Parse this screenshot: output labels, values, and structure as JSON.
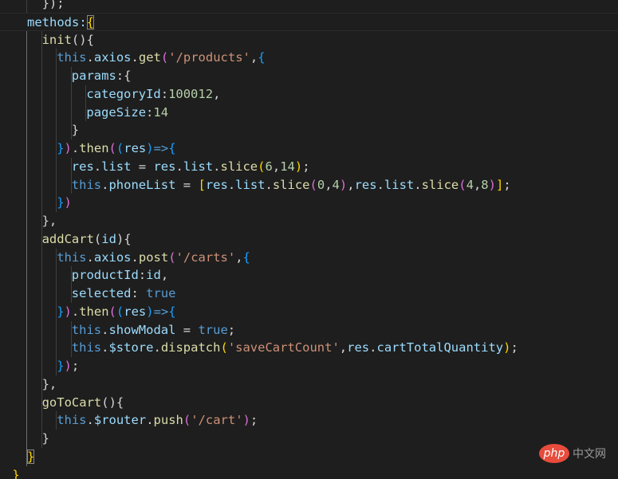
{
  "editor": {
    "lines": [
      {
        "indent": 2,
        "guides": [
          1
        ],
        "tokens": [
          {
            "t": "});",
            "c": "txt"
          }
        ]
      },
      {
        "indent": 1,
        "current": true,
        "guides": [],
        "tokens": [
          {
            "t": "methods:",
            "c": "prop"
          },
          {
            "t": "{",
            "c": "b1 bm"
          }
        ]
      },
      {
        "indent": 2,
        "guides": [
          1,
          2
        ],
        "tokens": [
          {
            "t": "init",
            "c": "fn"
          },
          {
            "t": "(){",
            "c": "txt"
          }
        ]
      },
      {
        "indent": 3,
        "guides": [
          1,
          2,
          3
        ],
        "tokens": [
          {
            "t": "this",
            "c": "kw"
          },
          {
            "t": ".",
            "c": "txt"
          },
          {
            "t": "axios",
            "c": "prop"
          },
          {
            "t": ".",
            "c": "txt"
          },
          {
            "t": "get",
            "c": "fn"
          },
          {
            "t": "(",
            "c": "b2"
          },
          {
            "t": "'/products'",
            "c": "str"
          },
          {
            "t": ",",
            "c": "txt"
          },
          {
            "t": "{",
            "c": "b3"
          }
        ]
      },
      {
        "indent": 4,
        "guides": [
          1,
          2,
          3,
          4
        ],
        "tokens": [
          {
            "t": "params",
            "c": "prop"
          },
          {
            "t": ":{",
            "c": "txt"
          }
        ]
      },
      {
        "indent": 5,
        "guides": [
          1,
          2,
          3,
          4,
          5
        ],
        "tokens": [
          {
            "t": "categoryId",
            "c": "prop"
          },
          {
            "t": ":",
            "c": "txt"
          },
          {
            "t": "100012",
            "c": "num"
          },
          {
            "t": ",",
            "c": "txt"
          }
        ]
      },
      {
        "indent": 5,
        "guides": [
          1,
          2,
          3,
          4,
          5
        ],
        "tokens": [
          {
            "t": "pageSize",
            "c": "prop"
          },
          {
            "t": ":",
            "c": "txt"
          },
          {
            "t": "14",
            "c": "num"
          }
        ]
      },
      {
        "indent": 4,
        "guides": [
          1,
          2,
          3,
          4
        ],
        "tokens": [
          {
            "t": "}",
            "c": "txt"
          }
        ]
      },
      {
        "indent": 3,
        "guides": [
          1,
          2,
          3
        ],
        "tokens": [
          {
            "t": "}",
            "c": "b3"
          },
          {
            "t": ")",
            "c": "b2"
          },
          {
            "t": ".",
            "c": "txt"
          },
          {
            "t": "then",
            "c": "fn"
          },
          {
            "t": "(",
            "c": "b2"
          },
          {
            "t": "(",
            "c": "b3"
          },
          {
            "t": "res",
            "c": "prop"
          },
          {
            "t": ")",
            "c": "b3"
          },
          {
            "t": "=>",
            "c": "kw"
          },
          {
            "t": "{",
            "c": "b3"
          }
        ]
      },
      {
        "indent": 4,
        "guides": [
          1,
          2,
          3,
          4
        ],
        "tokens": [
          {
            "t": "res",
            "c": "prop"
          },
          {
            "t": ".",
            "c": "txt"
          },
          {
            "t": "list",
            "c": "prop"
          },
          {
            "t": " = ",
            "c": "txt"
          },
          {
            "t": "res",
            "c": "prop"
          },
          {
            "t": ".",
            "c": "txt"
          },
          {
            "t": "list",
            "c": "prop"
          },
          {
            "t": ".",
            "c": "txt"
          },
          {
            "t": "slice",
            "c": "fn"
          },
          {
            "t": "(",
            "c": "b1"
          },
          {
            "t": "6",
            "c": "num"
          },
          {
            "t": ",",
            "c": "txt"
          },
          {
            "t": "14",
            "c": "num"
          },
          {
            "t": ")",
            "c": "b1"
          },
          {
            "t": ";",
            "c": "txt"
          }
        ]
      },
      {
        "indent": 4,
        "guides": [
          1,
          2,
          3,
          4
        ],
        "tokens": [
          {
            "t": "this",
            "c": "kw"
          },
          {
            "t": ".",
            "c": "txt"
          },
          {
            "t": "phoneList",
            "c": "prop"
          },
          {
            "t": " = ",
            "c": "txt"
          },
          {
            "t": "[",
            "c": "b1"
          },
          {
            "t": "res",
            "c": "prop"
          },
          {
            "t": ".",
            "c": "txt"
          },
          {
            "t": "list",
            "c": "prop"
          },
          {
            "t": ".",
            "c": "txt"
          },
          {
            "t": "slice",
            "c": "fn"
          },
          {
            "t": "(",
            "c": "b2"
          },
          {
            "t": "0",
            "c": "num"
          },
          {
            "t": ",",
            "c": "txt"
          },
          {
            "t": "4",
            "c": "num"
          },
          {
            "t": ")",
            "c": "b2"
          },
          {
            "t": ",",
            "c": "txt"
          },
          {
            "t": "res",
            "c": "prop"
          },
          {
            "t": ".",
            "c": "txt"
          },
          {
            "t": "list",
            "c": "prop"
          },
          {
            "t": ".",
            "c": "txt"
          },
          {
            "t": "slice",
            "c": "fn"
          },
          {
            "t": "(",
            "c": "b2"
          },
          {
            "t": "4",
            "c": "num"
          },
          {
            "t": ",",
            "c": "txt"
          },
          {
            "t": "8",
            "c": "num"
          },
          {
            "t": ")",
            "c": "b2"
          },
          {
            "t": "]",
            "c": "b1"
          },
          {
            "t": ";",
            "c": "txt"
          }
        ]
      },
      {
        "indent": 3,
        "guides": [
          1,
          2,
          3
        ],
        "tokens": [
          {
            "t": "}",
            "c": "b3"
          },
          {
            "t": ")",
            "c": "b2"
          }
        ]
      },
      {
        "indent": 2,
        "guides": [
          1,
          2
        ],
        "tokens": [
          {
            "t": "},",
            "c": "txt"
          }
        ]
      },
      {
        "indent": 2,
        "guides": [
          1,
          2
        ],
        "tokens": [
          {
            "t": "addCart",
            "c": "fn"
          },
          {
            "t": "(",
            "c": "txt"
          },
          {
            "t": "id",
            "c": "prop"
          },
          {
            "t": "){",
            "c": "txt"
          }
        ]
      },
      {
        "indent": 3,
        "guides": [
          1,
          2,
          3
        ],
        "tokens": [
          {
            "t": "this",
            "c": "kw"
          },
          {
            "t": ".",
            "c": "txt"
          },
          {
            "t": "axios",
            "c": "prop"
          },
          {
            "t": ".",
            "c": "txt"
          },
          {
            "t": "post",
            "c": "fn"
          },
          {
            "t": "(",
            "c": "b2"
          },
          {
            "t": "'/carts'",
            "c": "str"
          },
          {
            "t": ",",
            "c": "txt"
          },
          {
            "t": "{",
            "c": "b3"
          }
        ]
      },
      {
        "indent": 4,
        "guides": [
          1,
          2,
          3,
          4
        ],
        "tokens": [
          {
            "t": "productId",
            "c": "prop"
          },
          {
            "t": ":",
            "c": "txt"
          },
          {
            "t": "id",
            "c": "prop"
          },
          {
            "t": ",",
            "c": "txt"
          }
        ]
      },
      {
        "indent": 4,
        "guides": [
          1,
          2,
          3,
          4
        ],
        "tokens": [
          {
            "t": "selected",
            "c": "prop"
          },
          {
            "t": ": ",
            "c": "txt"
          },
          {
            "t": "true",
            "c": "kw"
          }
        ]
      },
      {
        "indent": 3,
        "guides": [
          1,
          2,
          3
        ],
        "tokens": [
          {
            "t": "}",
            "c": "b3"
          },
          {
            "t": ")",
            "c": "b2"
          },
          {
            "t": ".",
            "c": "txt"
          },
          {
            "t": "then",
            "c": "fn"
          },
          {
            "t": "(",
            "c": "b2"
          },
          {
            "t": "(",
            "c": "b3"
          },
          {
            "t": "res",
            "c": "prop"
          },
          {
            "t": ")",
            "c": "b3"
          },
          {
            "t": "=>",
            "c": "kw"
          },
          {
            "t": "{",
            "c": "b3"
          }
        ]
      },
      {
        "indent": 4,
        "guides": [
          1,
          2,
          3,
          4
        ],
        "tokens": [
          {
            "t": "this",
            "c": "kw"
          },
          {
            "t": ".",
            "c": "txt"
          },
          {
            "t": "showModal",
            "c": "prop"
          },
          {
            "t": " = ",
            "c": "txt"
          },
          {
            "t": "true",
            "c": "kw"
          },
          {
            "t": ";",
            "c": "txt"
          }
        ]
      },
      {
        "indent": 4,
        "guides": [
          1,
          2,
          3,
          4
        ],
        "tokens": [
          {
            "t": "this",
            "c": "kw"
          },
          {
            "t": ".",
            "c": "txt"
          },
          {
            "t": "$store",
            "c": "prop"
          },
          {
            "t": ".",
            "c": "txt"
          },
          {
            "t": "dispatch",
            "c": "fn"
          },
          {
            "t": "(",
            "c": "b1"
          },
          {
            "t": "'saveCartCount'",
            "c": "str"
          },
          {
            "t": ",",
            "c": "txt"
          },
          {
            "t": "res",
            "c": "prop"
          },
          {
            "t": ".",
            "c": "txt"
          },
          {
            "t": "cartTotalQuantity",
            "c": "prop"
          },
          {
            "t": ")",
            "c": "b1"
          },
          {
            "t": ";",
            "c": "txt"
          }
        ]
      },
      {
        "indent": 3,
        "guides": [
          1,
          2,
          3
        ],
        "tokens": [
          {
            "t": "}",
            "c": "b3"
          },
          {
            "t": ")",
            "c": "b2"
          },
          {
            "t": ";",
            "c": "txt"
          }
        ]
      },
      {
        "indent": 2,
        "guides": [
          1,
          2
        ],
        "tokens": [
          {
            "t": "},",
            "c": "txt"
          }
        ]
      },
      {
        "indent": 2,
        "guides": [
          1,
          2
        ],
        "tokens": [
          {
            "t": "goToCart",
            "c": "fn"
          },
          {
            "t": "(){",
            "c": "txt"
          }
        ]
      },
      {
        "indent": 3,
        "guides": [
          1,
          2,
          3
        ],
        "tokens": [
          {
            "t": "this",
            "c": "kw"
          },
          {
            "t": ".",
            "c": "txt"
          },
          {
            "t": "$router",
            "c": "prop"
          },
          {
            "t": ".",
            "c": "txt"
          },
          {
            "t": "push",
            "c": "fn"
          },
          {
            "t": "(",
            "c": "b2"
          },
          {
            "t": "'/cart'",
            "c": "str"
          },
          {
            "t": ")",
            "c": "b2"
          },
          {
            "t": ";",
            "c": "txt"
          }
        ]
      },
      {
        "indent": 2,
        "guides": [
          1,
          2
        ],
        "tokens": [
          {
            "t": "}",
            "c": "txt"
          }
        ]
      },
      {
        "indent": 1,
        "guides": [
          1
        ],
        "tokens": [
          {
            "t": "}",
            "c": "b1 bm"
          }
        ]
      },
      {
        "indent": 0,
        "guides": [],
        "tokens": [
          {
            "t": "}",
            "c": "b1"
          }
        ]
      }
    ]
  },
  "watermark": {
    "logo_text": "php",
    "site_text": "中文网"
  },
  "colors": {
    "background": "#1e1e1e",
    "keyword": "#569cd6",
    "function": "#dcdcaa",
    "property": "#9cdcfe",
    "string": "#ce9178",
    "number": "#b5cea8",
    "bracket_1": "#ffd700",
    "bracket_2": "#da70d6",
    "bracket_3": "#179fff"
  }
}
